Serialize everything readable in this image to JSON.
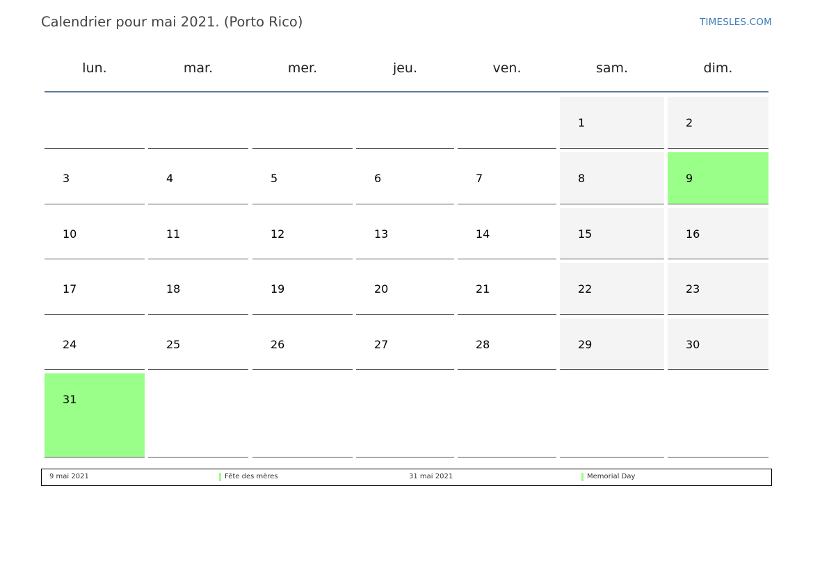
{
  "title": "Calendrier pour mai 2021. (Porto Rico)",
  "site": "TIMESLES.COM",
  "colors": {
    "weekend": "#f4f4f4",
    "holiday": "#99ff88",
    "header_rule": "#5b7899",
    "link": "#3a7ab7"
  },
  "weekdays": [
    "lun.",
    "mar.",
    "mer.",
    "jeu.",
    "ven.",
    "sam.",
    "dim."
  ],
  "weeks": [
    [
      {
        "day": ""
      },
      {
        "day": ""
      },
      {
        "day": ""
      },
      {
        "day": ""
      },
      {
        "day": ""
      },
      {
        "day": "1",
        "weekend": true
      },
      {
        "day": "2",
        "weekend": true
      }
    ],
    [
      {
        "day": "3"
      },
      {
        "day": "4"
      },
      {
        "day": "5"
      },
      {
        "day": "6"
      },
      {
        "day": "7"
      },
      {
        "day": "8",
        "weekend": true
      },
      {
        "day": "9",
        "weekend": true,
        "holiday": true
      }
    ],
    [
      {
        "day": "10"
      },
      {
        "day": "11"
      },
      {
        "day": "12"
      },
      {
        "day": "13"
      },
      {
        "day": "14"
      },
      {
        "day": "15",
        "weekend": true
      },
      {
        "day": "16",
        "weekend": true
      }
    ],
    [
      {
        "day": "17"
      },
      {
        "day": "18"
      },
      {
        "day": "19"
      },
      {
        "day": "20"
      },
      {
        "day": "21"
      },
      {
        "day": "22",
        "weekend": true
      },
      {
        "day": "23",
        "weekend": true
      }
    ],
    [
      {
        "day": "24"
      },
      {
        "day": "25"
      },
      {
        "day": "26"
      },
      {
        "day": "27"
      },
      {
        "day": "28"
      },
      {
        "day": "29",
        "weekend": true
      },
      {
        "day": "30",
        "weekend": true
      }
    ],
    [
      {
        "day": "31",
        "holiday": true
      },
      {
        "day": ""
      },
      {
        "day": ""
      },
      {
        "day": ""
      },
      {
        "day": ""
      },
      {
        "day": ""
      },
      {
        "day": ""
      }
    ]
  ],
  "holidays": [
    {
      "date": "9 mai 2021",
      "name": "Fête des mères"
    },
    {
      "date": "31 mai 2021",
      "name": "Memorial Day"
    }
  ]
}
